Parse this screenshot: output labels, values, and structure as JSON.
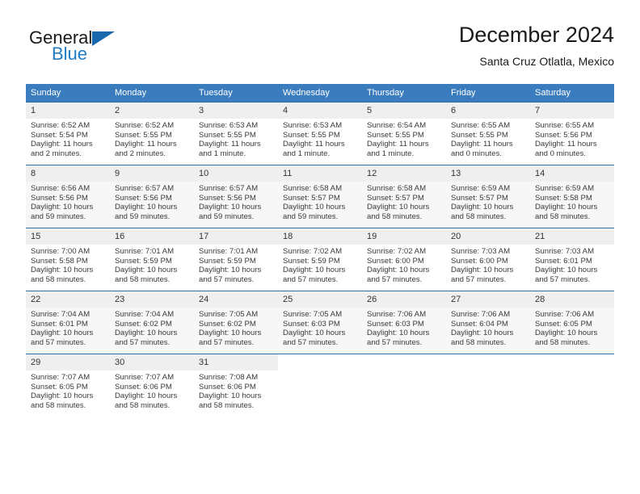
{
  "brand": {
    "line1": "General",
    "line2": "Blue",
    "flag_icon": "brand-flag-icon",
    "accent_color": "#1f7cc4"
  },
  "header": {
    "title": "December 2024",
    "subtitle": "Santa Cruz Otlatla, Mexico"
  },
  "colors": {
    "header_row": "#3a7cbe",
    "row_divider": "#2e6da4",
    "daynum_background": "#efefef",
    "shaded_week": "#f7f7f7"
  },
  "calendar": {
    "weekday_headers": [
      "Sunday",
      "Monday",
      "Tuesday",
      "Wednesday",
      "Thursday",
      "Friday",
      "Saturday"
    ],
    "weeks": [
      {
        "shaded": false,
        "days": [
          {
            "day": "1",
            "sunrise": "Sunrise: 6:52 AM",
            "sunset": "Sunset: 5:54 PM",
            "daylight": "Daylight: 11 hours and 2 minutes."
          },
          {
            "day": "2",
            "sunrise": "Sunrise: 6:52 AM",
            "sunset": "Sunset: 5:55 PM",
            "daylight": "Daylight: 11 hours and 2 minutes."
          },
          {
            "day": "3",
            "sunrise": "Sunrise: 6:53 AM",
            "sunset": "Sunset: 5:55 PM",
            "daylight": "Daylight: 11 hours and 1 minute."
          },
          {
            "day": "4",
            "sunrise": "Sunrise: 6:53 AM",
            "sunset": "Sunset: 5:55 PM",
            "daylight": "Daylight: 11 hours and 1 minute."
          },
          {
            "day": "5",
            "sunrise": "Sunrise: 6:54 AM",
            "sunset": "Sunset: 5:55 PM",
            "daylight": "Daylight: 11 hours and 1 minute."
          },
          {
            "day": "6",
            "sunrise": "Sunrise: 6:55 AM",
            "sunset": "Sunset: 5:55 PM",
            "daylight": "Daylight: 11 hours and 0 minutes."
          },
          {
            "day": "7",
            "sunrise": "Sunrise: 6:55 AM",
            "sunset": "Sunset: 5:56 PM",
            "daylight": "Daylight: 11 hours and 0 minutes."
          }
        ]
      },
      {
        "shaded": true,
        "days": [
          {
            "day": "8",
            "sunrise": "Sunrise: 6:56 AM",
            "sunset": "Sunset: 5:56 PM",
            "daylight": "Daylight: 10 hours and 59 minutes."
          },
          {
            "day": "9",
            "sunrise": "Sunrise: 6:57 AM",
            "sunset": "Sunset: 5:56 PM",
            "daylight": "Daylight: 10 hours and 59 minutes."
          },
          {
            "day": "10",
            "sunrise": "Sunrise: 6:57 AM",
            "sunset": "Sunset: 5:56 PM",
            "daylight": "Daylight: 10 hours and 59 minutes."
          },
          {
            "day": "11",
            "sunrise": "Sunrise: 6:58 AM",
            "sunset": "Sunset: 5:57 PM",
            "daylight": "Daylight: 10 hours and 59 minutes."
          },
          {
            "day": "12",
            "sunrise": "Sunrise: 6:58 AM",
            "sunset": "Sunset: 5:57 PM",
            "daylight": "Daylight: 10 hours and 58 minutes."
          },
          {
            "day": "13",
            "sunrise": "Sunrise: 6:59 AM",
            "sunset": "Sunset: 5:57 PM",
            "daylight": "Daylight: 10 hours and 58 minutes."
          },
          {
            "day": "14",
            "sunrise": "Sunrise: 6:59 AM",
            "sunset": "Sunset: 5:58 PM",
            "daylight": "Daylight: 10 hours and 58 minutes."
          }
        ]
      },
      {
        "shaded": false,
        "days": [
          {
            "day": "15",
            "sunrise": "Sunrise: 7:00 AM",
            "sunset": "Sunset: 5:58 PM",
            "daylight": "Daylight: 10 hours and 58 minutes."
          },
          {
            "day": "16",
            "sunrise": "Sunrise: 7:01 AM",
            "sunset": "Sunset: 5:59 PM",
            "daylight": "Daylight: 10 hours and 58 minutes."
          },
          {
            "day": "17",
            "sunrise": "Sunrise: 7:01 AM",
            "sunset": "Sunset: 5:59 PM",
            "daylight": "Daylight: 10 hours and 57 minutes."
          },
          {
            "day": "18",
            "sunrise": "Sunrise: 7:02 AM",
            "sunset": "Sunset: 5:59 PM",
            "daylight": "Daylight: 10 hours and 57 minutes."
          },
          {
            "day": "19",
            "sunrise": "Sunrise: 7:02 AM",
            "sunset": "Sunset: 6:00 PM",
            "daylight": "Daylight: 10 hours and 57 minutes."
          },
          {
            "day": "20",
            "sunrise": "Sunrise: 7:03 AM",
            "sunset": "Sunset: 6:00 PM",
            "daylight": "Daylight: 10 hours and 57 minutes."
          },
          {
            "day": "21",
            "sunrise": "Sunrise: 7:03 AM",
            "sunset": "Sunset: 6:01 PM",
            "daylight": "Daylight: 10 hours and 57 minutes."
          }
        ]
      },
      {
        "shaded": true,
        "days": [
          {
            "day": "22",
            "sunrise": "Sunrise: 7:04 AM",
            "sunset": "Sunset: 6:01 PM",
            "daylight": "Daylight: 10 hours and 57 minutes."
          },
          {
            "day": "23",
            "sunrise": "Sunrise: 7:04 AM",
            "sunset": "Sunset: 6:02 PM",
            "daylight": "Daylight: 10 hours and 57 minutes."
          },
          {
            "day": "24",
            "sunrise": "Sunrise: 7:05 AM",
            "sunset": "Sunset: 6:02 PM",
            "daylight": "Daylight: 10 hours and 57 minutes."
          },
          {
            "day": "25",
            "sunrise": "Sunrise: 7:05 AM",
            "sunset": "Sunset: 6:03 PM",
            "daylight": "Daylight: 10 hours and 57 minutes."
          },
          {
            "day": "26",
            "sunrise": "Sunrise: 7:06 AM",
            "sunset": "Sunset: 6:03 PM",
            "daylight": "Daylight: 10 hours and 57 minutes."
          },
          {
            "day": "27",
            "sunrise": "Sunrise: 7:06 AM",
            "sunset": "Sunset: 6:04 PM",
            "daylight": "Daylight: 10 hours and 58 minutes."
          },
          {
            "day": "28",
            "sunrise": "Sunrise: 7:06 AM",
            "sunset": "Sunset: 6:05 PM",
            "daylight": "Daylight: 10 hours and 58 minutes."
          }
        ]
      },
      {
        "shaded": false,
        "days": [
          {
            "day": "29",
            "sunrise": "Sunrise: 7:07 AM",
            "sunset": "Sunset: 6:05 PM",
            "daylight": "Daylight: 10 hours and 58 minutes."
          },
          {
            "day": "30",
            "sunrise": "Sunrise: 7:07 AM",
            "sunset": "Sunset: 6:06 PM",
            "daylight": "Daylight: 10 hours and 58 minutes."
          },
          {
            "day": "31",
            "sunrise": "Sunrise: 7:08 AM",
            "sunset": "Sunset: 6:06 PM",
            "daylight": "Daylight: 10 hours and 58 minutes."
          },
          null,
          null,
          null,
          null
        ]
      }
    ]
  }
}
